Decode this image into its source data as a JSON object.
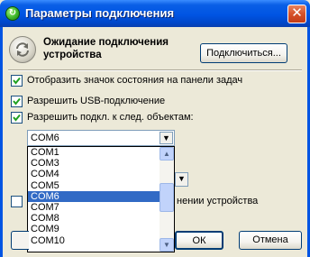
{
  "window": {
    "title": "Параметры подключения",
    "close_glyph": "✕"
  },
  "status": {
    "text": "Ожидание подключения устройства",
    "connect_label": "Подключиться..."
  },
  "checkboxes": [
    {
      "label": "Отобразить значок состояния на панели задач",
      "checked": true
    },
    {
      "label": "Разрешить USB-подключение",
      "checked": true
    },
    {
      "label": "Разрешить подкл. к след. объектам:",
      "checked": true
    }
  ],
  "port_combo": {
    "value": "COM6"
  },
  "dropdown": {
    "items": [
      "COM1",
      "COM3",
      "COM4",
      "COM5",
      "COM6",
      "COM7",
      "COM8",
      "COM9",
      "COM10"
    ],
    "selected": "COM6"
  },
  "partial": {
    "label": "нении устройства"
  },
  "buttons": {
    "ok": "ОК",
    "cancel": "Отмена"
  },
  "icons": {
    "title": "app-sync-icon",
    "status": "sync-arrows-icon",
    "combo_arrow": "chevron-down-icon",
    "scroll_up": "chevron-up-icon",
    "scroll_down": "chevron-down-icon"
  },
  "colors": {
    "titlebar": "#0054e3",
    "selection": "#316ac5",
    "close": "#d6522a"
  }
}
